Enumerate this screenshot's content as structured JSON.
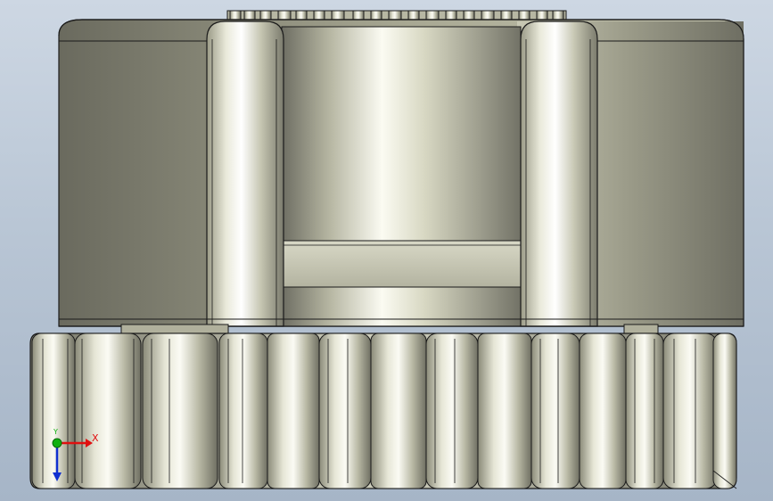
{
  "scene": {
    "type": "cad-3d-model-viewport",
    "object": "gear-motor-assembly",
    "background_colors": [
      "#cdd7e3",
      "#a6b5c7"
    ],
    "metal_colors": {
      "light": "#f4f4ea",
      "mid": "#c9c9b4",
      "dark": "#6e6e62",
      "edge": "#1a1a1a"
    }
  },
  "triad": {
    "x_label": "X",
    "y_label": "Y",
    "x_color": "#e01010",
    "y_color": "#10b010",
    "z_color": "#1030d0"
  }
}
